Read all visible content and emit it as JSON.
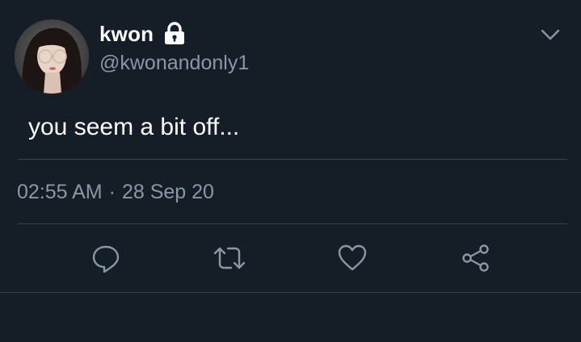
{
  "tweet": {
    "author": {
      "display_name": "kwon",
      "handle": "@kwonandonly1",
      "protected_icon": "lock-icon",
      "avatar": "avatar"
    },
    "text": "you seem a bit off...",
    "time": "02:55 AM",
    "separator": "·",
    "date": "28 Sep 20",
    "menu_icon": "chevron-down-icon",
    "actions": [
      {
        "icon": "reply-icon"
      },
      {
        "icon": "retweet-icon"
      },
      {
        "icon": "like-icon"
      },
      {
        "icon": "share-icon"
      }
    ]
  },
  "colors": {
    "background": "#151d26",
    "primary_text": "#ffffff",
    "secondary_text": "#8899a6",
    "divider": "#38444d"
  }
}
